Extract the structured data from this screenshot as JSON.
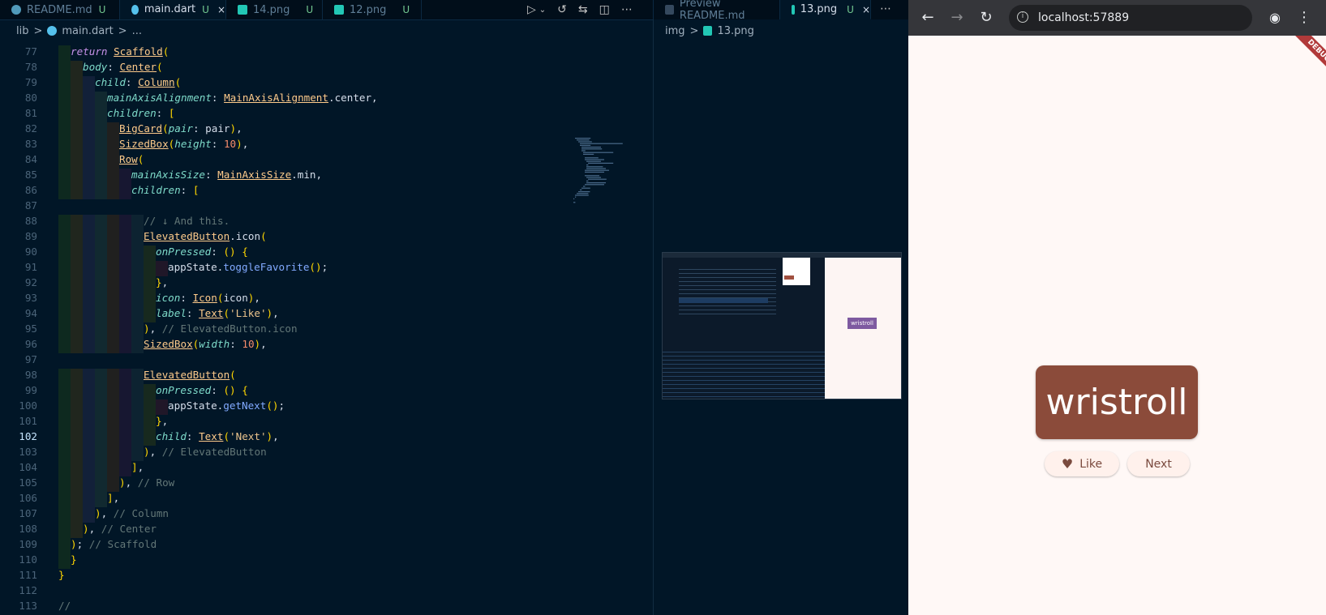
{
  "tabs": [
    {
      "label": "README.md",
      "badge": "U",
      "icon_color": "#519aba",
      "active": false
    },
    {
      "label": "main.dart",
      "badge": "U",
      "icon_color": "#55c1ec",
      "active": true,
      "close": "×"
    },
    {
      "label": "14.png",
      "badge": "U",
      "icon_color": "#22c7b5",
      "active": false
    },
    {
      "label": "12.png",
      "badge": "U",
      "icon_color": "#22c7b5",
      "active": false
    },
    {
      "label": "Preview README.md",
      "badge": "",
      "icon_color": "#519aba",
      "active": false
    },
    {
      "label": "13.png",
      "badge": "U",
      "icon_color": "#22c7b5",
      "active": true,
      "close": "×"
    }
  ],
  "toolbar_icons": [
    "run-debug-icon",
    "chevron-down-icon",
    "history-icon",
    "compare-icon",
    "split-editor-icon",
    "more-icon"
  ],
  "breadcrumb": {
    "folder": "lib",
    "separator": ">",
    "file": "main.dart",
    "rest": "..."
  },
  "preview_breadcrumb": {
    "folder": "img",
    "separator": ">",
    "file": "13.png"
  },
  "code": {
    "current_line": 102,
    "lines": [
      {
        "n": 77,
        "indent": 1,
        "text": "return Scaffold("
      },
      {
        "n": 78,
        "indent": 2,
        "text": "body: Center("
      },
      {
        "n": 79,
        "indent": 3,
        "text": "child: Column("
      },
      {
        "n": 80,
        "indent": 4,
        "text": "mainAxisAlignment: MainAxisAlignment.center,"
      },
      {
        "n": 81,
        "indent": 4,
        "text": "children: ["
      },
      {
        "n": 82,
        "indent": 5,
        "text": "BigCard(pair: pair),"
      },
      {
        "n": 83,
        "indent": 5,
        "text": "SizedBox(height: 10),"
      },
      {
        "n": 84,
        "indent": 5,
        "text": "Row("
      },
      {
        "n": 85,
        "indent": 6,
        "text": "mainAxisSize: MainAxisSize.min,"
      },
      {
        "n": 86,
        "indent": 6,
        "text": "children: ["
      },
      {
        "n": 87,
        "indent": 0,
        "text": ""
      },
      {
        "n": 88,
        "indent": 7,
        "text": "// ↓ And this."
      },
      {
        "n": 89,
        "indent": 7,
        "text": "ElevatedButton.icon("
      },
      {
        "n": 90,
        "indent": 8,
        "text": "onPressed: () {"
      },
      {
        "n": 91,
        "indent": 9,
        "text": "appState.toggleFavorite();"
      },
      {
        "n": 92,
        "indent": 8,
        "text": "},"
      },
      {
        "n": 93,
        "indent": 8,
        "text": "icon: Icon(icon),"
      },
      {
        "n": 94,
        "indent": 8,
        "text": "label: Text('Like'),"
      },
      {
        "n": 95,
        "indent": 7,
        "text": "), // ElevatedButton.icon"
      },
      {
        "n": 96,
        "indent": 7,
        "text": "SizedBox(width: 10),"
      },
      {
        "n": 97,
        "indent": 0,
        "text": ""
      },
      {
        "n": 98,
        "indent": 7,
        "text": "ElevatedButton("
      },
      {
        "n": 99,
        "indent": 8,
        "text": "onPressed: () {"
      },
      {
        "n": 100,
        "indent": 9,
        "text": "appState.getNext();"
      },
      {
        "n": 101,
        "indent": 8,
        "text": "},"
      },
      {
        "n": 102,
        "indent": 8,
        "text": "child: Text('Next'),"
      },
      {
        "n": 103,
        "indent": 7,
        "text": "), // ElevatedButton"
      },
      {
        "n": 104,
        "indent": 6,
        "text": "],"
      },
      {
        "n": 105,
        "indent": 5,
        "text": "), // Row"
      },
      {
        "n": 106,
        "indent": 4,
        "text": "],"
      },
      {
        "n": 107,
        "indent": 3,
        "text": "), // Column"
      },
      {
        "n": 108,
        "indent": 2,
        "text": "), // Center"
      },
      {
        "n": 109,
        "indent": 1,
        "text": "); // Scaffold"
      },
      {
        "n": 110,
        "indent": 1,
        "text": "}"
      },
      {
        "n": 111,
        "indent": 0,
        "text": "}"
      },
      {
        "n": 112,
        "indent": 0,
        "text": ""
      },
      {
        "n": 113,
        "indent": 0,
        "text": "//"
      }
    ]
  },
  "browser": {
    "url": "localhost:57889",
    "debug_banner": "DEBUG",
    "word": "wristroll",
    "like_label": "Like",
    "next_label": "Next",
    "card_color": "#8b4b3a",
    "background": "#fff8f6"
  }
}
